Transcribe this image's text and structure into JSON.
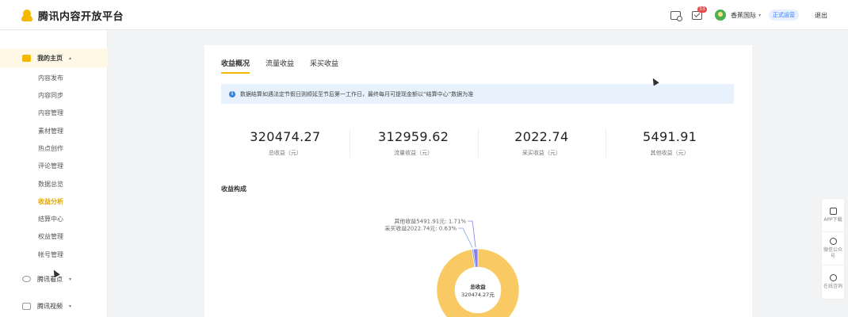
{
  "header": {
    "logo_text": "腾讯内容开放平台",
    "notification_count": "33",
    "user_name": "香蕉国际",
    "account_tag": "正式运营",
    "logout_label": "退出"
  },
  "sidebar": {
    "groups": [
      {
        "label": "我的主页"
      },
      {
        "label": "腾讯看点"
      },
      {
        "label": "腾讯视频"
      }
    ],
    "items": [
      {
        "label": "内容发布"
      },
      {
        "label": "内容同步"
      },
      {
        "label": "内容管理"
      },
      {
        "label": "素材管理"
      },
      {
        "label": "热点创作"
      },
      {
        "label": "评论管理"
      },
      {
        "label": "数据总览"
      },
      {
        "label": "收益分析"
      },
      {
        "label": "结算中心"
      },
      {
        "label": "权益管理"
      },
      {
        "label": "帐号管理"
      }
    ]
  },
  "tabs": [
    {
      "label": "收益概况"
    },
    {
      "label": "流量收益"
    },
    {
      "label": "采买收益"
    }
  ],
  "notice": {
    "text": "数据结算如遇法定节假日则顺延至节后第一工作日，最终每月可提现金额以“结算中心”数据为准"
  },
  "stats": [
    {
      "value": "320474.27",
      "label": "总收益（元）"
    },
    {
      "value": "312959.62",
      "label": "流量收益（元）"
    },
    {
      "value": "2022.74",
      "label": "采买收益（元）"
    },
    {
      "value": "5491.91",
      "label": "其他收益（元）"
    }
  ],
  "section": {
    "title": "收益构成"
  },
  "chart_data": {
    "type": "pie",
    "title": "",
    "center_label": "总收益",
    "center_value": "320474.27元",
    "slices": [
      {
        "name": "流量收益",
        "value": 312959.62,
        "color": "#f9c963"
      },
      {
        "name": "采买收益",
        "value": 2022.74,
        "color": "#7ba3f0",
        "label": "采买收益2022.74元: 0.63%"
      },
      {
        "name": "其他收益",
        "value": 5491.91,
        "color": "#8a7ee8",
        "label": "其他收益5491.91元: 1.71%"
      }
    ]
  },
  "float_bar": {
    "items": [
      {
        "label": "APP下载",
        "icon": "phone-icon"
      },
      {
        "label": "微信公众号",
        "icon": "wechat-icon"
      },
      {
        "label": "在线咨询",
        "icon": "headset-icon"
      }
    ]
  },
  "colors": {
    "accent": "#f5b800",
    "notice_bg": "#e8f2fc",
    "info": "#3a82d6"
  }
}
